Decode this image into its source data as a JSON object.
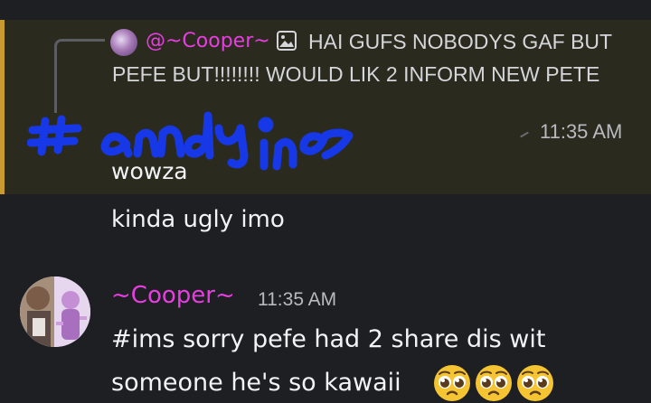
{
  "highlighted_message": {
    "reply": {
      "username": "@~Cooper~",
      "preview_line1": "HAI GUFS NOBODYS GAF BUT",
      "preview_line2": "PEFE BUT!!!!!!!! WOULD LIK 2 INFORM NEW PETE"
    },
    "timestamp": "11:35 AM",
    "body": "wowza",
    "drawing": {
      "color": "#1638e6",
      "icon": "handwritten-scribble"
    }
  },
  "followup_message": "kinda ugly imo",
  "message": {
    "author": "~Cooper~",
    "timestamp": "11:35 AM",
    "line1": "#ims sorry pefe had 2 share dis wit",
    "line2": "someone he's so kawaii",
    "emoji": [
      "pleading-face",
      "pleading-face",
      "pleading-face"
    ]
  },
  "colors": {
    "background": "#1e1f22",
    "highlight_background": "#2b2a1f",
    "highlight_bar": "#c99b2e",
    "username": "#e63ee0",
    "text": "#f2f3f5",
    "muted": "#b9bac0"
  }
}
